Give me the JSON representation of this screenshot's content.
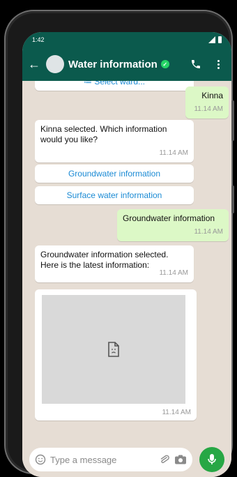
{
  "status_bar": {
    "time": "1:42"
  },
  "header": {
    "title": "Water information",
    "verified": "✓"
  },
  "messages": {
    "top_partial_label": "≔ Select ward...",
    "msg1": {
      "text": "Kinna",
      "time": "11.14 AM"
    },
    "msg2": {
      "text": "Kinna selected. Which information would you like?",
      "time": "11.14 AM"
    },
    "options": [
      "Groundwater information",
      "Surface water information"
    ],
    "msg3": {
      "text": "Groundwater information",
      "time": "11.14 AM"
    },
    "msg4": {
      "text": "Groundwater information selected. Here is the latest information:",
      "time": "11.14 AM"
    },
    "image_msg": {
      "time": "11.14 AM"
    }
  },
  "composer": {
    "placeholder": "Type a message"
  },
  "colors": {
    "header": "#0b5a4d",
    "outgoing": "#dcf8c6",
    "chat_bg": "#e6ddd4",
    "accent": "#25d366",
    "link": "#1a8ad4"
  }
}
